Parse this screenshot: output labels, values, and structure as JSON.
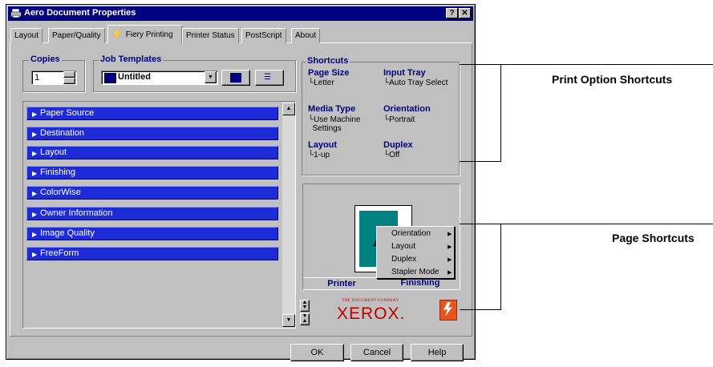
{
  "window": {
    "title": "Aero Document Properties",
    "help_btn": "?",
    "close_btn": "✕"
  },
  "tabs": [
    {
      "label": "Layout"
    },
    {
      "label": "Paper/Quality"
    },
    {
      "label": "Fiery Printing"
    },
    {
      "label": "Printer Status"
    },
    {
      "label": "PostScript"
    },
    {
      "label": "About"
    }
  ],
  "copies": {
    "label": "Copies",
    "value": "1"
  },
  "job_templates": {
    "label": "Job Templates",
    "value": "Untitled"
  },
  "sections": [
    {
      "label": "Paper Source"
    },
    {
      "label": "Destination"
    },
    {
      "label": "Layout"
    },
    {
      "label": "Finishing"
    },
    {
      "label": "ColorWise"
    },
    {
      "label": "Owner Information"
    },
    {
      "label": "Image Quality"
    },
    {
      "label": "FreeForm"
    }
  ],
  "shortcuts": {
    "label": "Shortcuts",
    "items": [
      {
        "label": "Page Size",
        "value": "Letter"
      },
      {
        "label": "Input Tray",
        "value": "Auto Tray Select"
      },
      {
        "label": "Media Type",
        "value": "Use Machine",
        "value2": "Settings"
      },
      {
        "label": "Orientation",
        "value": "Portrait"
      },
      {
        "label": "Layout",
        "value": "1-up"
      },
      {
        "label": "Duplex",
        "value": "Off"
      }
    ]
  },
  "preview": {
    "page_letter": "A",
    "tab_printer": "Printer",
    "tab_finishing": "Finishing"
  },
  "context_menu": [
    {
      "label": "Orientation"
    },
    {
      "label": "Layout"
    },
    {
      "label": "Duplex"
    },
    {
      "label": "Stapler Mode"
    }
  ],
  "logo": {
    "tagline": "THE DOCUMENT COMPANY",
    "brand": "XEROX."
  },
  "buttons": {
    "ok": "OK",
    "cancel": "Cancel",
    "help": "Help"
  },
  "annotations": {
    "print_option_shortcuts": "Print Option Shortcuts",
    "page_shortcuts": "Page Shortcuts"
  },
  "colors": {
    "titlebar": "#000080",
    "section_row": "#1e2bd9",
    "label_blue": "#000080",
    "preview_page": "#008080"
  }
}
